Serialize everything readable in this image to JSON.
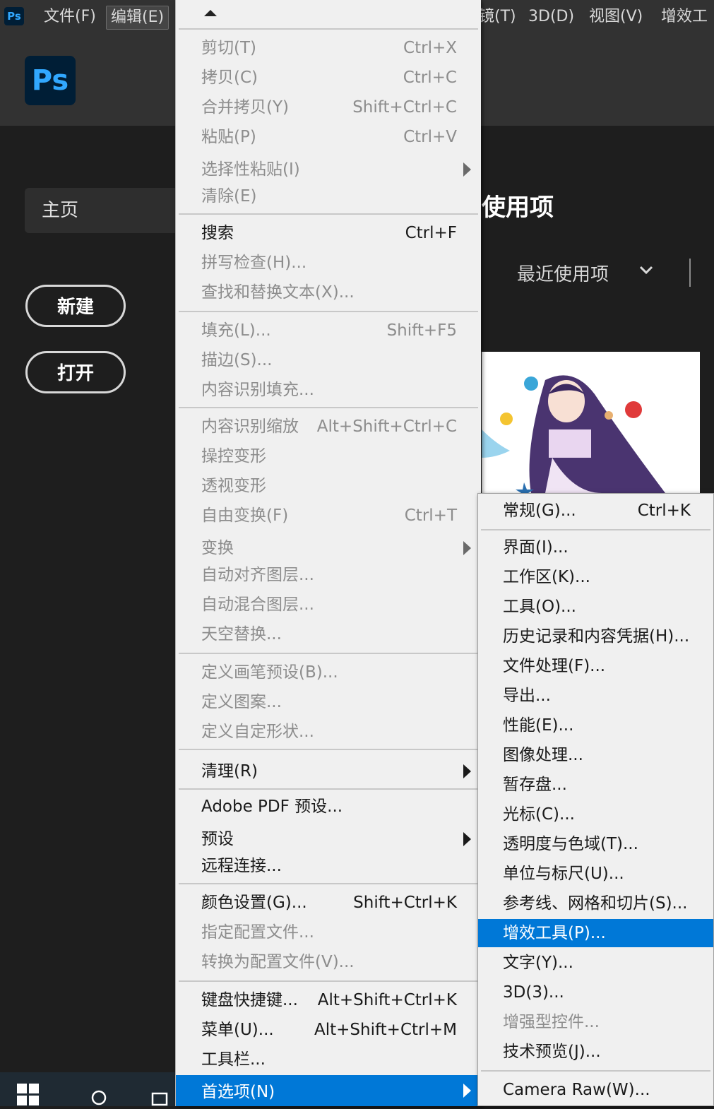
{
  "menubar": {
    "app_icon": "Ps",
    "items": [
      "文件(F)",
      "编辑(E)",
      "镜(T)",
      "3D(D)",
      "视图(V)",
      "增效工"
    ]
  },
  "home": {
    "logo": "Ps",
    "home_tab": "主页",
    "new_button": "新建",
    "open_button": "打开",
    "recent_heading": "使用项",
    "sort_label": "最近使用项"
  },
  "edit_menu": {
    "items": [
      {
        "label": "剪切(T)",
        "shortcut": "Ctrl+X",
        "disabled": true
      },
      {
        "label": "拷贝(C)",
        "shortcut": "Ctrl+C",
        "disabled": true
      },
      {
        "label": "合并拷贝(Y)",
        "shortcut": "Shift+Ctrl+C",
        "disabled": true
      },
      {
        "label": "粘贴(P)",
        "shortcut": "Ctrl+V",
        "disabled": true
      },
      {
        "label": "选择性粘贴(I)",
        "shortcut": "",
        "disabled": true,
        "submenu": true
      },
      {
        "label": "清除(E)",
        "shortcut": "",
        "disabled": true
      },
      {
        "label": "搜索",
        "shortcut": "Ctrl+F",
        "disabled": false
      },
      {
        "label": "拼写检查(H)...",
        "shortcut": "",
        "disabled": true
      },
      {
        "label": "查找和替换文本(X)...",
        "shortcut": "",
        "disabled": true
      },
      {
        "label": "填充(L)...",
        "shortcut": "Shift+F5",
        "disabled": true
      },
      {
        "label": "描边(S)...",
        "shortcut": "",
        "disabled": true
      },
      {
        "label": "内容识别填充...",
        "shortcut": "",
        "disabled": true
      },
      {
        "label": "内容识别缩放",
        "shortcut": "Alt+Shift+Ctrl+C",
        "disabled": true
      },
      {
        "label": "操控变形",
        "shortcut": "",
        "disabled": true
      },
      {
        "label": "透视变形",
        "shortcut": "",
        "disabled": true
      },
      {
        "label": "自由变换(F)",
        "shortcut": "Ctrl+T",
        "disabled": true
      },
      {
        "label": "变换",
        "shortcut": "",
        "disabled": true,
        "submenu": true
      },
      {
        "label": "自动对齐图层...",
        "shortcut": "",
        "disabled": true
      },
      {
        "label": "自动混合图层...",
        "shortcut": "",
        "disabled": true
      },
      {
        "label": "天空替换...",
        "shortcut": "",
        "disabled": true
      },
      {
        "label": "定义画笔预设(B)...",
        "shortcut": "",
        "disabled": true
      },
      {
        "label": "定义图案...",
        "shortcut": "",
        "disabled": true
      },
      {
        "label": "定义自定形状...",
        "shortcut": "",
        "disabled": true
      },
      {
        "label": "清理(R)",
        "shortcut": "",
        "disabled": false,
        "submenu": true
      },
      {
        "label": "Adobe PDF 预设...",
        "shortcut": "",
        "disabled": false
      },
      {
        "label": "预设",
        "shortcut": "",
        "disabled": false,
        "submenu": true
      },
      {
        "label": "远程连接...",
        "shortcut": "",
        "disabled": false
      },
      {
        "label": "颜色设置(G)...",
        "shortcut": "Shift+Ctrl+K",
        "disabled": false
      },
      {
        "label": "指定配置文件...",
        "shortcut": "",
        "disabled": true
      },
      {
        "label": "转换为配置文件(V)...",
        "shortcut": "",
        "disabled": true
      },
      {
        "label": "键盘快捷键...",
        "shortcut": "Alt+Shift+Ctrl+K",
        "disabled": false
      },
      {
        "label": "菜单(U)...",
        "shortcut": "Alt+Shift+Ctrl+M",
        "disabled": false
      },
      {
        "label": "工具栏...",
        "shortcut": "",
        "disabled": false
      },
      {
        "label": "首选项(N)",
        "shortcut": "",
        "disabled": false,
        "submenu": true,
        "highlighted": true
      }
    ]
  },
  "preferences_menu": {
    "items": [
      {
        "label": "常规(G)...",
        "shortcut": "Ctrl+K",
        "disabled": false
      },
      {
        "label": "界面(I)...",
        "shortcut": "",
        "disabled": false
      },
      {
        "label": "工作区(K)...",
        "shortcut": "",
        "disabled": false
      },
      {
        "label": "工具(O)...",
        "shortcut": "",
        "disabled": false
      },
      {
        "label": "历史记录和内容凭据(H)...",
        "shortcut": "",
        "disabled": false
      },
      {
        "label": "文件处理(F)...",
        "shortcut": "",
        "disabled": false
      },
      {
        "label": "导出...",
        "shortcut": "",
        "disabled": false
      },
      {
        "label": "性能(E)...",
        "shortcut": "",
        "disabled": false
      },
      {
        "label": "图像处理...",
        "shortcut": "",
        "disabled": false
      },
      {
        "label": "暂存盘...",
        "shortcut": "",
        "disabled": false
      },
      {
        "label": "光标(C)...",
        "shortcut": "",
        "disabled": false
      },
      {
        "label": "透明度与色域(T)...",
        "shortcut": "",
        "disabled": false
      },
      {
        "label": "单位与标尺(U)...",
        "shortcut": "",
        "disabled": false
      },
      {
        "label": "参考线、网格和切片(S)...",
        "shortcut": "",
        "disabled": false
      },
      {
        "label": "增效工具(P)...",
        "shortcut": "",
        "disabled": false,
        "highlighted": true
      },
      {
        "label": "文字(Y)...",
        "shortcut": "",
        "disabled": false
      },
      {
        "label": "3D(3)...",
        "shortcut": "",
        "disabled": false
      },
      {
        "label": "增强型控件...",
        "shortcut": "",
        "disabled": true
      },
      {
        "label": "技术预览(J)...",
        "shortcut": "",
        "disabled": false
      },
      {
        "label": "Camera Raw(W)...",
        "shortcut": "",
        "disabled": false
      }
    ]
  },
  "colors": {
    "highlight": "#0078d7",
    "menu_bg": "#f0f0f0",
    "disabled_text": "#8d8d8d",
    "ps_blue": "#31a8ff",
    "ps_bg": "#001e36"
  }
}
